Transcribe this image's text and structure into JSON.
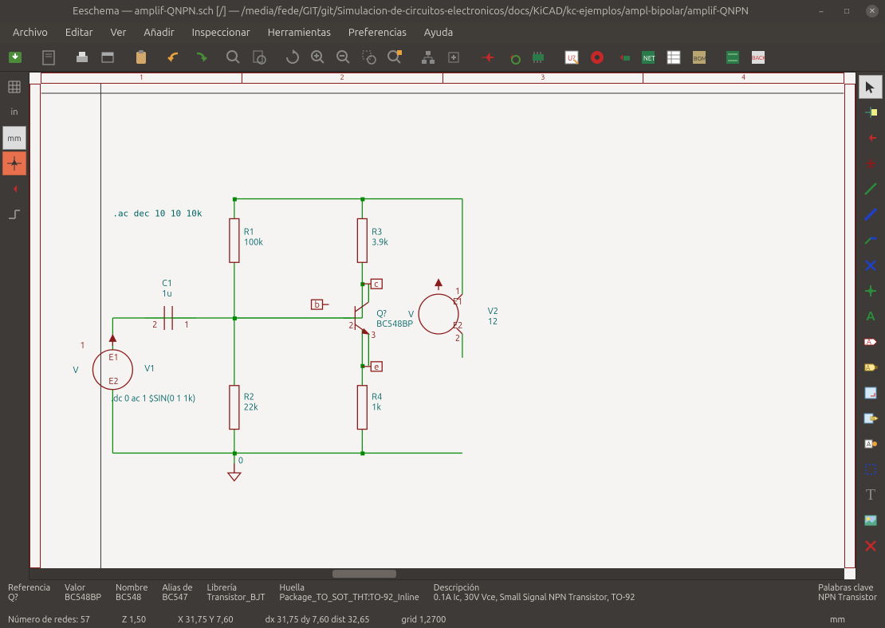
{
  "title": "Eeschema — amplif-QNPN.sch [/] — /media/fede/GIT/git/Simulacion-de-circuitos-electronicos/docs/KiCAD/kc-ejemplos/ampl-bipolar/amplif-QNPN",
  "menu": [
    "Archivo",
    "Editar",
    "Ver",
    "Añadir",
    "Inspeccionar",
    "Herramientas",
    "Preferencias",
    "Ayuda"
  ],
  "ruler_top": [
    "1",
    "2",
    "3",
    "4"
  ],
  "left_labels": {
    "grid": "",
    "in": "in",
    "mm": "mm"
  },
  "detail": {
    "ref_lbl": "Referencia",
    "ref": "Q?",
    "val_lbl": "Valor",
    "val": "BC548BP",
    "name_lbl": "Nombre",
    "name": "BC548",
    "alias_lbl": "Alias de",
    "alias": "BC547",
    "lib_lbl": "Librería",
    "lib": "Transistor_BJT",
    "fp_lbl": "Huella",
    "fp": "Package_TO_SOT_THT:TO-92_Inline",
    "desc_lbl": "Descripción",
    "desc": "0.1A Ic, 30V Vce, Small Signal NPN Transistor, TO-92",
    "kw_lbl": "Palabras clave",
    "kw": "NPN Transistor"
  },
  "status": {
    "nets": "Número de redes: 57",
    "z": "Z 1,50",
    "xy": "X 31,75  Y 7,60",
    "dxy": "dx 31,75  dy 7,60  dist 32,65",
    "grid": "grid 1,2700",
    "unit": "mm"
  },
  "schem": {
    "ac": ".ac dec 10 10 10k",
    "r1": "R1",
    "r1v": "100k",
    "r2": "R2",
    "r2v": "22k",
    "r3": "R3",
    "r3v": "3.9k",
    "r4": "R4",
    "r4v": "1k",
    "c1": "C1",
    "c1v": "1u",
    "q": "Q?",
    "qv": "BC548BP",
    "v1": "V1",
    "v1d": ".dc 0 ac 1 $SIN(0 1 1k)",
    "v2": "V2",
    "v2v": "12",
    "e1": "E1",
    "e2": "E2",
    "p1": "1",
    "p2": "2",
    "p3": "3",
    "b": "b",
    "c": "c",
    "e": "e",
    "zero": "0",
    "v": "V",
    "pin2": "2",
    "pin1": "1"
  }
}
